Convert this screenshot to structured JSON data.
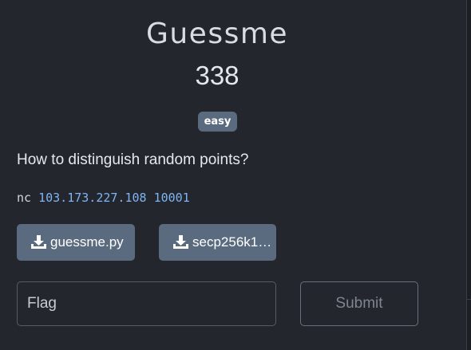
{
  "challenge": {
    "name": "Guessme",
    "points": "338",
    "difficulty": "easy",
    "description": "How to distinguish random points?",
    "command_prefix": "nc",
    "command_host": "103.173.227.108 10001"
  },
  "files": [
    {
      "label": "guessme.py",
      "icon": "download-icon"
    },
    {
      "label": "secp256k1…",
      "icon": "download-icon"
    }
  ],
  "form": {
    "flag_placeholder": "Flag",
    "submit_label": "Submit"
  },
  "colors": {
    "background": "#23272d",
    "badge": "#5a6b80",
    "file_button": "#5a6b80",
    "link": "#7fb4f3"
  }
}
